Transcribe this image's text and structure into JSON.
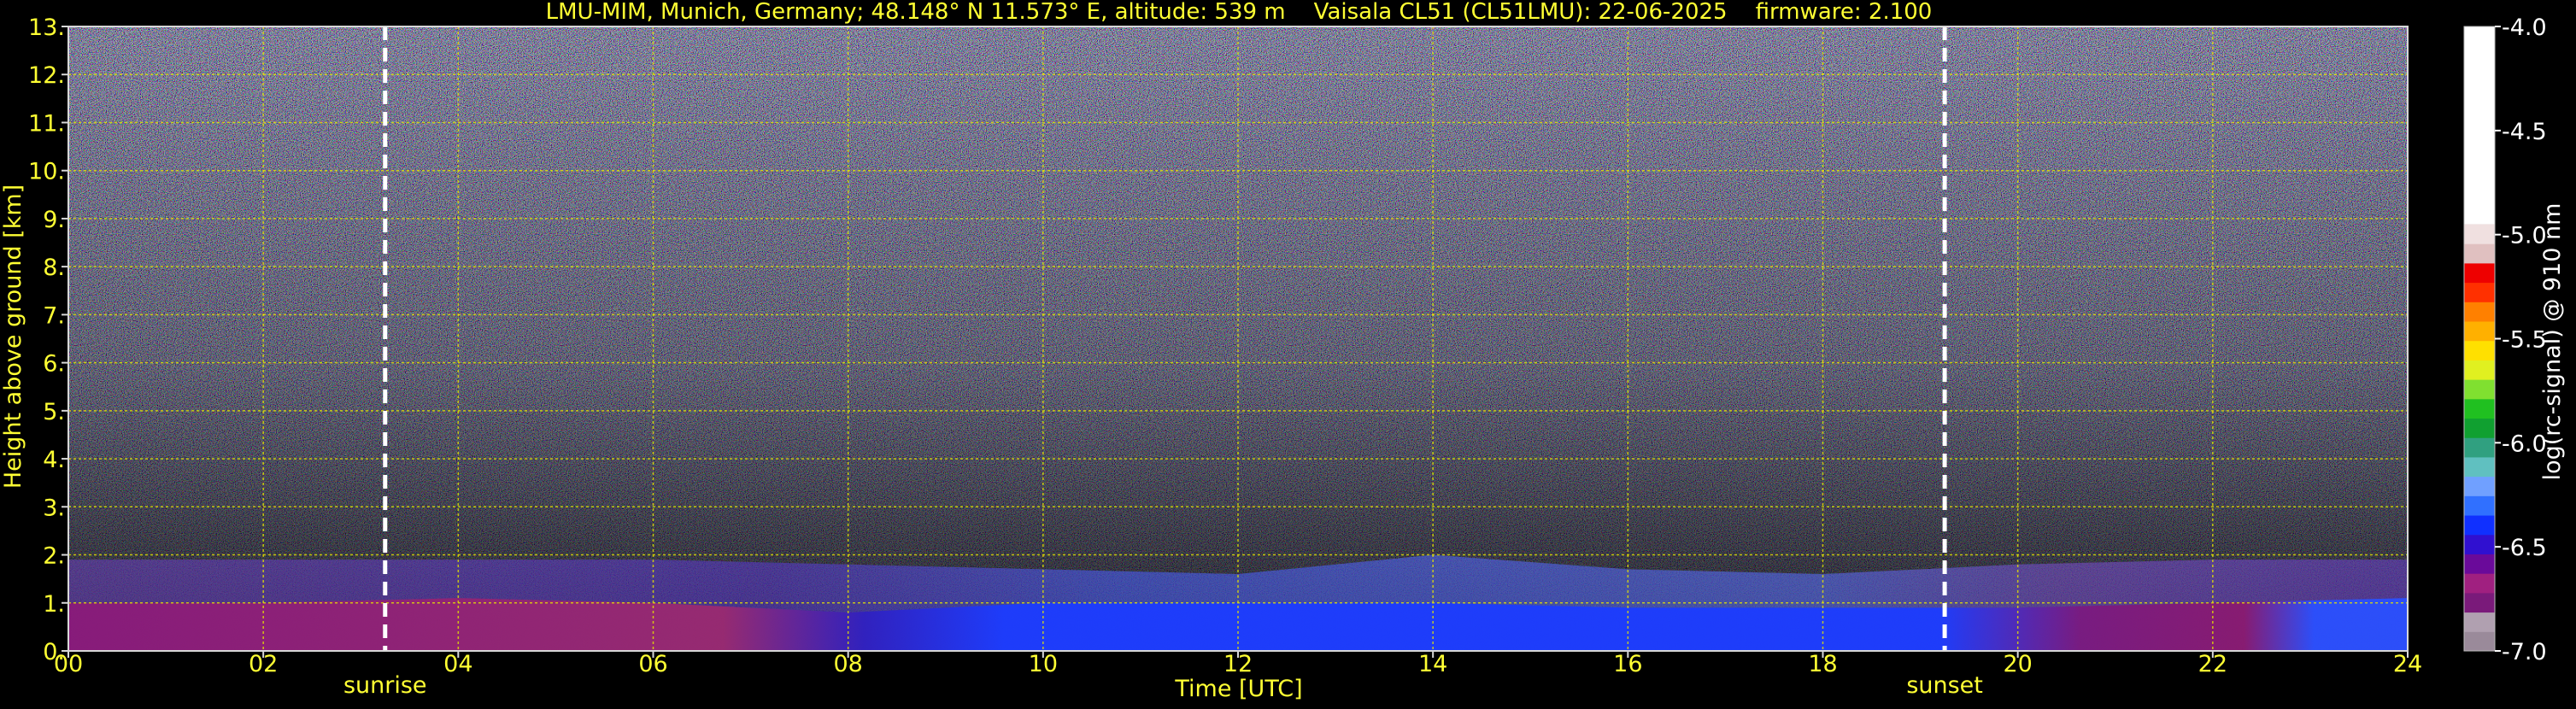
{
  "chart_data": {
    "type": "heatmap",
    "title": "LMU-MIM, Munich, Germany; 48.148° N 11.573° E, altitude: 539 m    Vaisala CL51 (CL51LMU): 22-06-2025    firmware: 2.100",
    "xlabel": "Time [UTC]",
    "ylabel": "Height above ground [km]",
    "xlim": [
      0,
      24
    ],
    "ylim": [
      0,
      13
    ],
    "x_ticks": [
      0,
      2,
      4,
      6,
      8,
      10,
      12,
      14,
      16,
      18,
      20,
      22,
      24
    ],
    "x_tick_labels": [
      "00",
      "02",
      "04",
      "06",
      "08",
      "10",
      "12",
      "14",
      "16",
      "18",
      "20",
      "22",
      "24"
    ],
    "y_ticks": [
      0,
      1,
      2,
      3,
      4,
      5,
      6,
      7,
      8,
      9,
      10,
      11,
      12,
      13
    ],
    "y_tick_labels": [
      "0.",
      "1.",
      "2.",
      "3.",
      "4.",
      "5.",
      "6.",
      "7.",
      "8.",
      "9.",
      "10.",
      "11.",
      "12.",
      "13."
    ],
    "grid": true,
    "annotations": [
      {
        "label": "sunrise",
        "x": 3.25
      },
      {
        "label": "sunset",
        "x": 19.25
      }
    ],
    "colorbar": {
      "label": "log(rc-signal) @ 910 nm",
      "range": [
        -7.0,
        -4.0
      ],
      "ticks": [
        -7.0,
        -6.5,
        -6.0,
        -5.5,
        -5.0,
        -4.5,
        -4.0
      ],
      "tick_labels": [
        "-7.0",
        "-6.5",
        "-6.0",
        "-5.5",
        "-5.0",
        "-4.5",
        "-4.0"
      ],
      "colors": [
        "#9a8a9a",
        "#b0a0b0",
        "#7a1a7a",
        "#a02080",
        "#6a0a9a",
        "#3010d0",
        "#1030ff",
        "#3070ff",
        "#70a0ff",
        "#60c0c0",
        "#30a080",
        "#10a030",
        "#20c020",
        "#80e030",
        "#e0f020",
        "#ffe000",
        "#ffb000",
        "#ff8000",
        "#ff3000",
        "#ee0000",
        "#e0c0c0",
        "#f0e0e0",
        "#ffffff"
      ]
    },
    "signal_layers": [
      {
        "name": "surface layer",
        "t": [
          0,
          2,
          4,
          6,
          8,
          10,
          12,
          14,
          16,
          18,
          20,
          22,
          24
        ],
        "top_km": [
          1.0,
          1.0,
          1.1,
          1.0,
          0.8,
          1.0,
          1.0,
          1.0,
          0.9,
          0.9,
          0.9,
          1.0,
          1.1
        ]
      },
      {
        "name": "residual layer",
        "t": [
          0,
          2,
          4,
          6,
          8,
          10,
          12,
          14,
          16,
          18,
          20,
          22,
          24
        ],
        "top_km": [
          1.9,
          1.9,
          1.9,
          1.9,
          1.8,
          1.7,
          1.6,
          2.0,
          1.7,
          1.6,
          1.8,
          1.9,
          1.9
        ]
      }
    ]
  }
}
